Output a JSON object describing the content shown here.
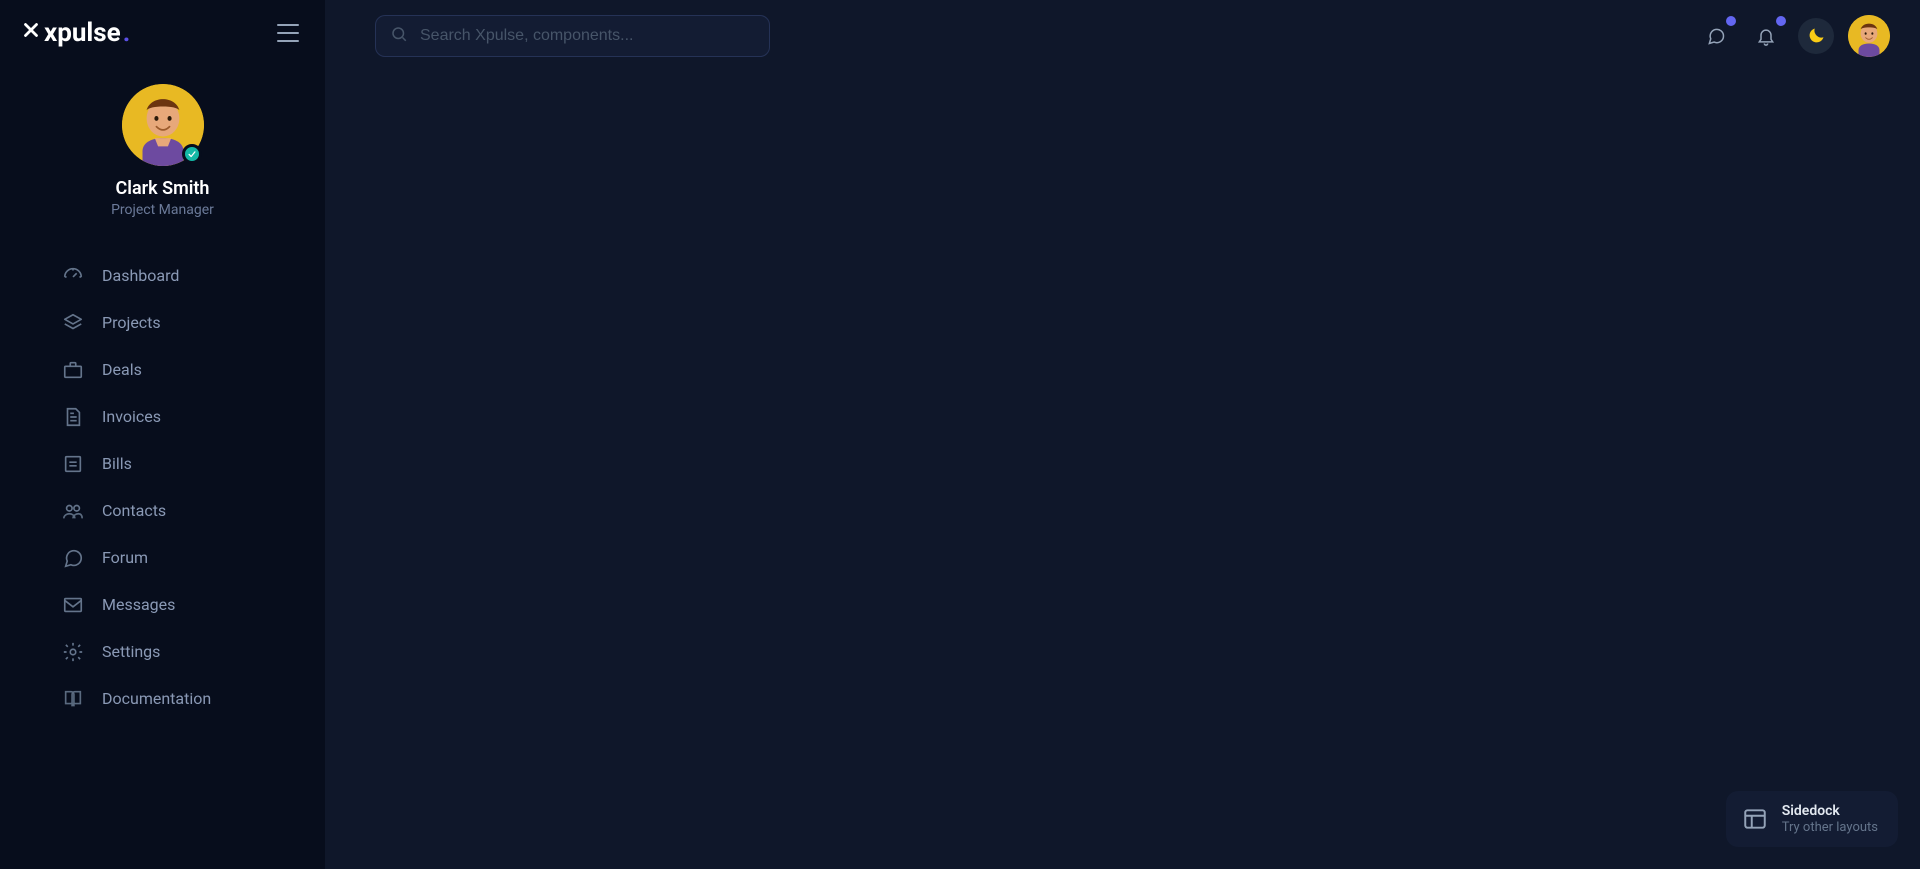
{
  "brand": {
    "name": "xpulse",
    "accent": "#5b50e6"
  },
  "user": {
    "name": "Clark Smith",
    "role": "Project Manager",
    "status": "online"
  },
  "search": {
    "placeholder": "Search Xpulse, components..."
  },
  "sidebar": {
    "items": [
      {
        "label": "Dashboard",
        "icon": "gauge-icon"
      },
      {
        "label": "Projects",
        "icon": "layers-icon"
      },
      {
        "label": "Deals",
        "icon": "briefcase-icon"
      },
      {
        "label": "Invoices",
        "icon": "file-text-icon"
      },
      {
        "label": "Bills",
        "icon": "receipt-icon"
      },
      {
        "label": "Contacts",
        "icon": "users-icon"
      },
      {
        "label": "Forum",
        "icon": "chat-icon"
      },
      {
        "label": "Messages",
        "icon": "mail-icon"
      },
      {
        "label": "Settings",
        "icon": "gear-icon"
      },
      {
        "label": "Documentation",
        "icon": "book-icon"
      }
    ]
  },
  "topbar": {
    "chat_badge": true,
    "bell_badge": true
  },
  "sidedock": {
    "title": "Sidedock",
    "subtitle": "Try other layouts"
  }
}
